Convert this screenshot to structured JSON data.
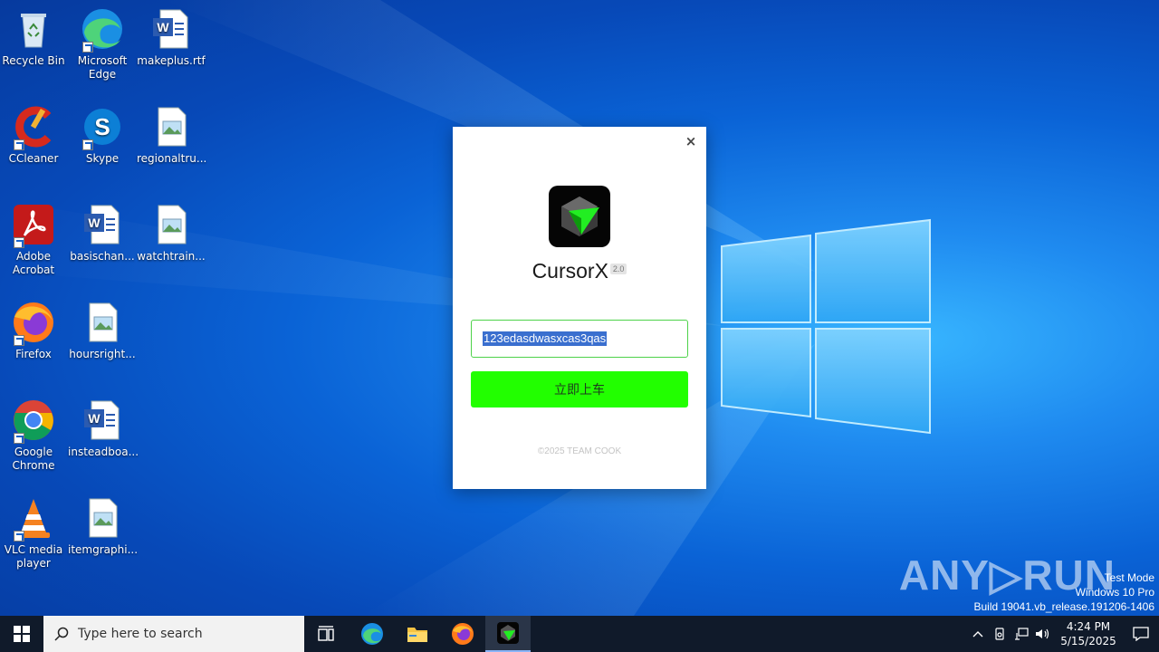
{
  "desktop": {
    "icons": [
      {
        "label": "Recycle Bin",
        "icon": "recycle-bin-icon"
      },
      {
        "label": "Microsoft Edge",
        "icon": "edge-icon"
      },
      {
        "label": "makeplus.rtf",
        "icon": "word-doc-icon"
      },
      {
        "label": "CCleaner",
        "icon": "ccleaner-icon"
      },
      {
        "label": "Skype",
        "icon": "skype-icon"
      },
      {
        "label": "regionaltru...",
        "icon": "image-file-icon"
      },
      {
        "label": "Adobe Acrobat",
        "icon": "acrobat-icon"
      },
      {
        "label": "basischan...",
        "icon": "word-doc-icon"
      },
      {
        "label": "watchtrain...",
        "icon": "image-file-icon"
      },
      {
        "label": "Firefox",
        "icon": "firefox-icon"
      },
      {
        "label": "hoursright...",
        "icon": "image-file-icon"
      },
      {
        "label": "Google Chrome",
        "icon": "chrome-icon"
      },
      {
        "label": "insteadboa...",
        "icon": "word-doc-icon"
      },
      {
        "label": "VLC media player",
        "icon": "vlc-icon"
      },
      {
        "label": "itemgraphi...",
        "icon": "image-file-icon"
      }
    ]
  },
  "dialog": {
    "close_label": "×",
    "app_name": "CursorX",
    "version": "2.0",
    "key_value": "123edasdwasxcas3qas",
    "button_label": "立即上车",
    "copyright": "©2025 TEAM COOK",
    "colors": {
      "button": "#22ff00",
      "input_border": "#4dd24a"
    }
  },
  "watermark": {
    "text": "ANY▷RUN",
    "line1": "Test Mode",
    "line2": "Windows 10 Pro",
    "line3": "Build 19041.vb_release.191206-1406"
  },
  "taskbar": {
    "search_placeholder": "Type here to search",
    "time": "4:24 PM",
    "date": "5/15/2025"
  }
}
